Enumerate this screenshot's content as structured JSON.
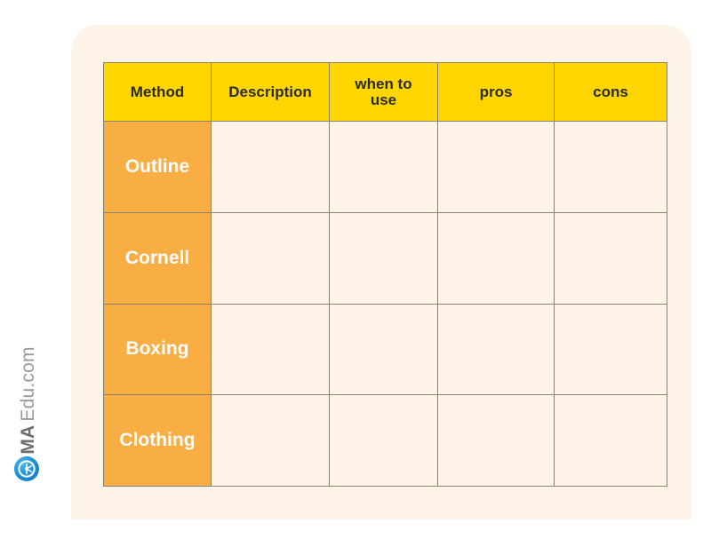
{
  "page": {
    "background_color": "#ffffff",
    "card_color": "#fdf3e7"
  },
  "watermark": {
    "brand_bold": "DMA",
    "brand_light": "Edu.com",
    "logo_name": "dma-edu-logo",
    "logo_color": "#1f93dd"
  },
  "table": {
    "header_color": "#ffd600",
    "method_color": "#f9ae44",
    "cell_color": "#fdf3e7",
    "border_color": "#8a8070",
    "columns": [
      {
        "key": "method",
        "label": "Method"
      },
      {
        "key": "description",
        "label": "Description"
      },
      {
        "key": "when_to_use",
        "label": "when to\nuse"
      },
      {
        "key": "pros",
        "label": "pros"
      },
      {
        "key": "cons",
        "label": "cons"
      }
    ],
    "rows": [
      {
        "method": "Outline",
        "description": "",
        "when_to_use": "",
        "pros": "",
        "cons": ""
      },
      {
        "method": "Cornell",
        "description": "",
        "when_to_use": "",
        "pros": "",
        "cons": ""
      },
      {
        "method": "Boxing",
        "description": "",
        "when_to_use": "",
        "pros": "",
        "cons": ""
      },
      {
        "method": "Clothing",
        "description": "",
        "when_to_use": "",
        "pros": "",
        "cons": ""
      }
    ]
  }
}
